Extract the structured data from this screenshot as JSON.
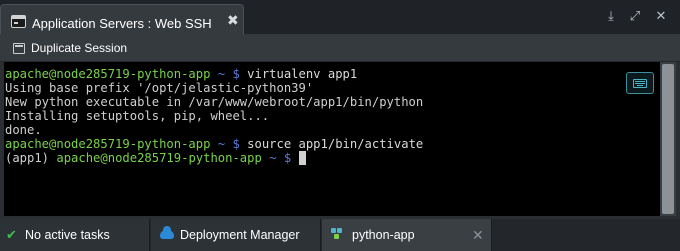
{
  "window": {
    "tab_title": "Application Servers : Web SSH",
    "tab_close_icon": "close-icon",
    "controls": [
      "download-icon",
      "expand-icon",
      "close-icon"
    ]
  },
  "toolbar": {
    "duplicate_label": "Duplicate Session"
  },
  "terminal": {
    "lines": [
      {
        "prompt": "apache@node285719-python-app",
        "sep": " ~ $ ",
        "text": "virtualenv app1"
      },
      {
        "text": "Using base prefix '/opt/jelastic-python39'"
      },
      {
        "text": "New python executable in /var/www/webroot/app1/bin/python"
      },
      {
        "text": "Installing setuptools, pip, wheel..."
      },
      {
        "text": "done."
      },
      {
        "prompt": "apache@node285719-python-app",
        "sep": " ~ $ ",
        "text": "source app1/bin/activate"
      },
      {
        "pre": "(app1) ",
        "prompt": "apache@node285719-python-app",
        "sep": " ~ $ ",
        "text": ""
      }
    ],
    "keyboard_icon": "keyboard-icon"
  },
  "bottom_tabs": [
    {
      "label": "No active tasks",
      "icon": "check-icon"
    },
    {
      "label": "Deployment Manager",
      "icon": "cloud-icon"
    },
    {
      "label": "python-app",
      "icon": "nodes-icon",
      "close_icon": "close-icon"
    }
  ],
  "colors": {
    "prompt": "#7ad14a",
    "prompt_symbol": "#5b7bd9",
    "terminal_bg": "#000000",
    "chrome_bg": "#353a3f"
  }
}
